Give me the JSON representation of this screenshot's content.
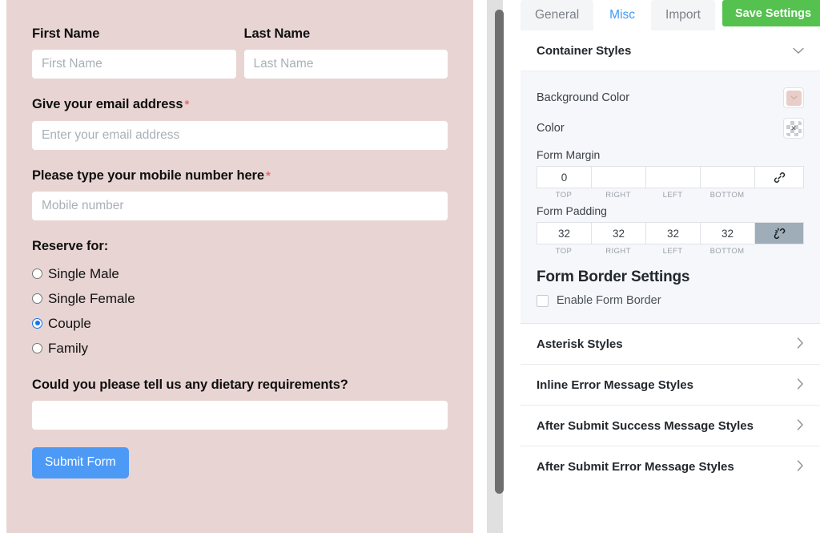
{
  "form_preview": {
    "background_color": "#e8d5d3",
    "fields": [
      {
        "label": "First Name",
        "placeholder": "First Name",
        "required": false,
        "type": "text",
        "name": "first-name"
      },
      {
        "label": "Last Name",
        "placeholder": "Last Name",
        "required": false,
        "type": "text",
        "name": "last-name"
      },
      {
        "label": "Give your email address",
        "placeholder": "Enter your email address",
        "required": true,
        "type": "email",
        "name": "email"
      },
      {
        "label": "Please type your mobile number here",
        "placeholder": "Mobile number",
        "required": true,
        "type": "tel",
        "name": "mobile"
      }
    ],
    "required_marker": "*",
    "radio_group": {
      "label": "Reserve for:",
      "options": [
        "Single Male",
        "Single Female",
        "Couple",
        "Family"
      ],
      "selected": "Couple",
      "selected_color": "#1b73e8"
    },
    "dietary": {
      "label": "Could you please tell us any dietary requirements?",
      "value": "",
      "placeholder": ""
    },
    "submit": {
      "label": "Submit Form",
      "color": "#4d9af6"
    }
  },
  "settings_panel": {
    "tabs": [
      {
        "label": "General",
        "active": false
      },
      {
        "label": "Misc",
        "active": true
      },
      {
        "label": "Import",
        "active": false
      }
    ],
    "active_tab_color": "#3f9bf5",
    "save_button": {
      "label": "Save Settings",
      "color": "#55c14e"
    },
    "container_styles": {
      "title": "Container Styles",
      "expanded": true,
      "chevron": "chevron-down-icon",
      "background_color": {
        "label": "Background Color",
        "swatch": "#e8cdc9"
      },
      "color": {
        "label": "Color",
        "swatch": "transparent"
      },
      "form_margin": {
        "title": "Form Margin",
        "values": [
          "0",
          "",
          "",
          ""
        ],
        "labels": [
          "TOP",
          "RIGHT",
          "LEFT",
          "BOTTOM"
        ],
        "link_icon": "link-icon",
        "link_active": false
      },
      "form_padding": {
        "title": "Form Padding",
        "values": [
          "32",
          "32",
          "32",
          "32"
        ],
        "labels": [
          "TOP",
          "RIGHT",
          "LEFT",
          "BOTTOM"
        ],
        "link_icon": "broken-link-icon",
        "link_active": true
      },
      "form_border": {
        "title": "Form Border Settings",
        "checkbox_label": "Enable Form Border",
        "checked": false
      }
    },
    "collapsed_sections": [
      {
        "title": "Asterisk Styles",
        "chevron": "chevron-right-icon"
      },
      {
        "title": "Inline Error Message Styles",
        "chevron": "chevron-right-icon"
      },
      {
        "title": "After Submit Success Message Styles",
        "chevron": "chevron-right-icon"
      },
      {
        "title": "After Submit Error Message Styles",
        "chevron": "chevron-right-icon"
      }
    ]
  },
  "scrollbar": {
    "name": "vertical-scrollbar",
    "thumb_color": "#6e6e6e"
  }
}
